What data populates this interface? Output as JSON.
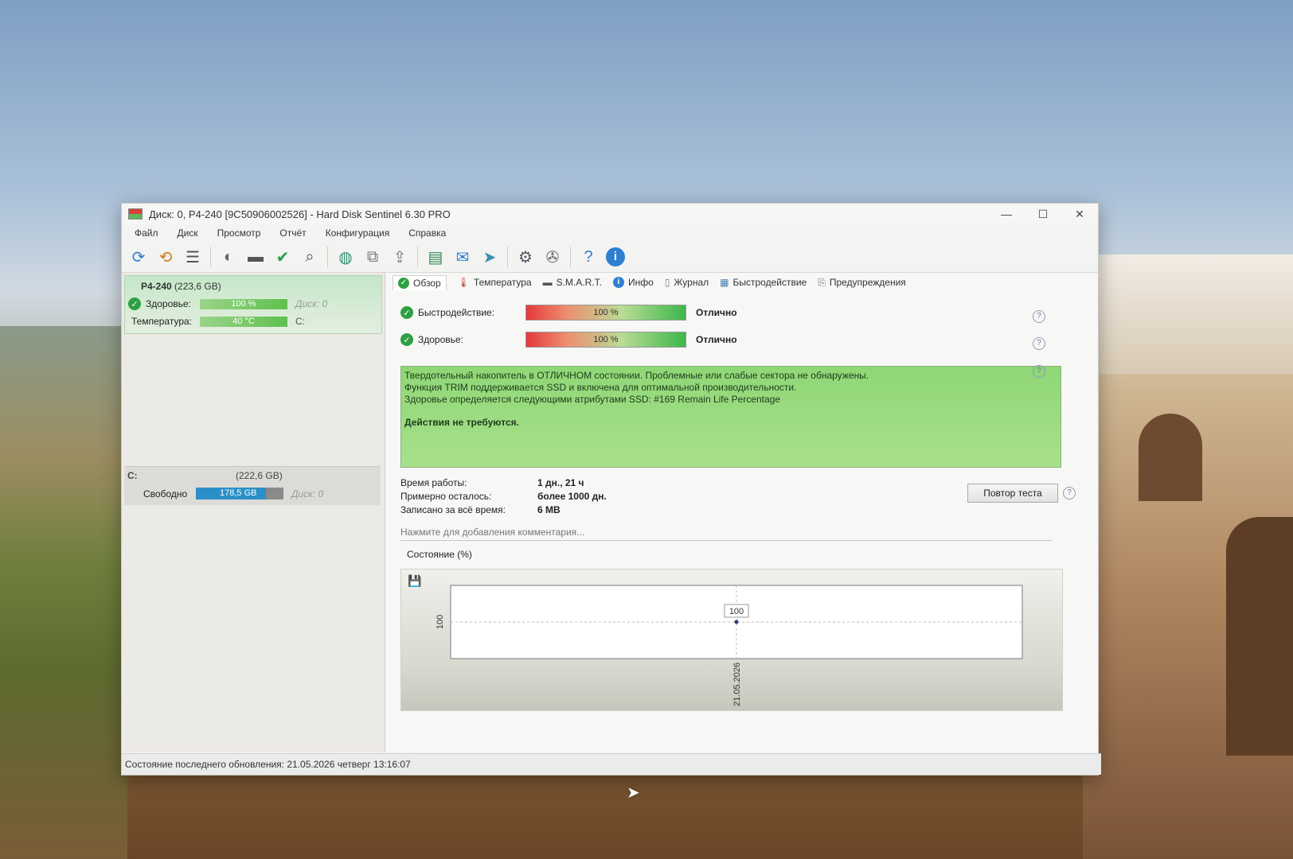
{
  "window": {
    "title": "Диск: 0, P4-240 [9C50906002526]  -  Hard Disk Sentinel 6.30 PRO",
    "controls": {
      "minimize": "—",
      "maximize": "☐",
      "close": "✕"
    }
  },
  "menu": [
    "Файл",
    "Диск",
    "Просмотр",
    "Отчёт",
    "Конфигурация",
    "Справка"
  ],
  "toolbar_icons": [
    "refresh-icon",
    "refresh-all-icon",
    "list-icon",
    "disk-icon",
    "disk-info-icon",
    "disk-check-icon",
    "disk-search-icon",
    "globe-icon",
    "network-icon",
    "export-icon",
    "report-icon",
    "mail-icon",
    "send-icon",
    "gear-icon",
    "settings-icon",
    "help-icon",
    "info-icon"
  ],
  "left": {
    "disk": {
      "name": "P4-240",
      "size": "(223,6 GB)",
      "health_label": "Здоровье:",
      "health_value": "100 %",
      "health_disk": "Диск: 0",
      "temp_label": "Температура:",
      "temp_value": "40 °C",
      "temp_drive": "C:"
    },
    "volume": {
      "letter": "C:",
      "size": "(222,6 GB)",
      "free_label": "Свободно",
      "free_value": "178,5 GB",
      "free_fraction": 0.8,
      "disk": "Диск: 0"
    }
  },
  "tabs": [
    {
      "label": "Обзор",
      "icon": "check-icon",
      "active": true
    },
    {
      "label": "Температура",
      "icon": "thermometer-icon"
    },
    {
      "label": "S.M.A.R.T.",
      "icon": "smart-icon"
    },
    {
      "label": "Инфо",
      "icon": "info-icon"
    },
    {
      "label": "Журнал",
      "icon": "log-icon"
    },
    {
      "label": "Быстродействие",
      "icon": "performance-icon"
    },
    {
      "label": "Предупреждения",
      "icon": "warning-icon"
    }
  ],
  "overview": {
    "performance_label": "Быстродействие:",
    "performance_value": "100 %",
    "performance_grade": "Отлично",
    "health_label": "Здоровье:",
    "health_value": "100 %",
    "health_grade": "Отлично",
    "status_lines": [
      "Твердотельный накопитель в ОТЛИЧНОМ состоянии. Проблемные или слабые сектора не обнаружены.",
      "Функция TRIM поддерживается SSD и включена для оптимальной производительности.",
      "Здоровье определяется следующими атрибутами SSD: #169 Remain Life Percentage"
    ],
    "status_action": "Действия не требуются.",
    "uptime_label": "Время работы:",
    "uptime_value": "1 дн., 21 ч",
    "remaining_label": "Примерно осталось:",
    "remaining_value": "более 1000 дн.",
    "written_label": "Записано за всё время:",
    "written_value": "6 MB",
    "retest_button": "Повтор теста",
    "comment_placeholder": "Нажмите для добавления комментария...",
    "chart_title": "Состояние (%)"
  },
  "chart_data": {
    "type": "line",
    "title": "Состояние (%)",
    "x": [
      "21.05.2026"
    ],
    "series": [
      {
        "values": [
          100
        ]
      }
    ],
    "ylabel": "",
    "yticks": [
      "100"
    ],
    "data_labels": [
      "100"
    ]
  },
  "statusbar": "Состояние последнего обновления: 21.05.2026 четверг 13:16:07"
}
